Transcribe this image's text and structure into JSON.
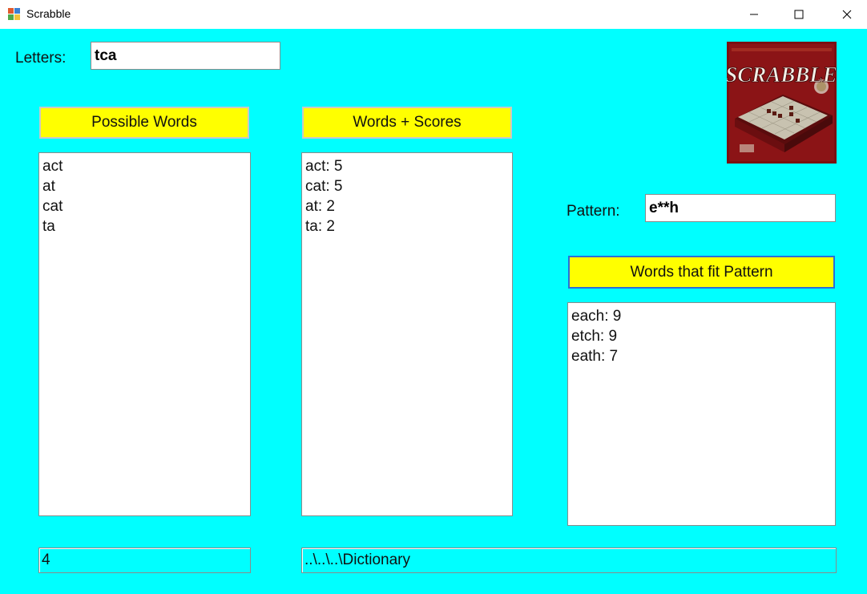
{
  "window": {
    "title": "Scrabble"
  },
  "letters": {
    "label": "Letters:",
    "value": "tca"
  },
  "possible_words": {
    "button_label": "Possible Words",
    "items": [
      "act",
      "at",
      "cat",
      "ta"
    ]
  },
  "words_scores": {
    "button_label": "Words + Scores",
    "items": [
      "act: 5",
      "cat: 5",
      "at: 2",
      "ta: 2"
    ]
  },
  "pattern": {
    "label": "Pattern:",
    "value": "e**h"
  },
  "pattern_words": {
    "button_label": "Words that fit Pattern",
    "items": [
      "each: 9",
      "etch: 9",
      "eath: 7"
    ]
  },
  "count_box": {
    "value": "4"
  },
  "path_box": {
    "value": "..\\..\\..\\Dictionary"
  },
  "box_art": {
    "brand_text": "SCRABBLE",
    "colors": {
      "box_red": "#8b1416",
      "board": "#c8c2b0"
    }
  },
  "colors": {
    "background": "#00ffff",
    "button": "#ffff00"
  }
}
